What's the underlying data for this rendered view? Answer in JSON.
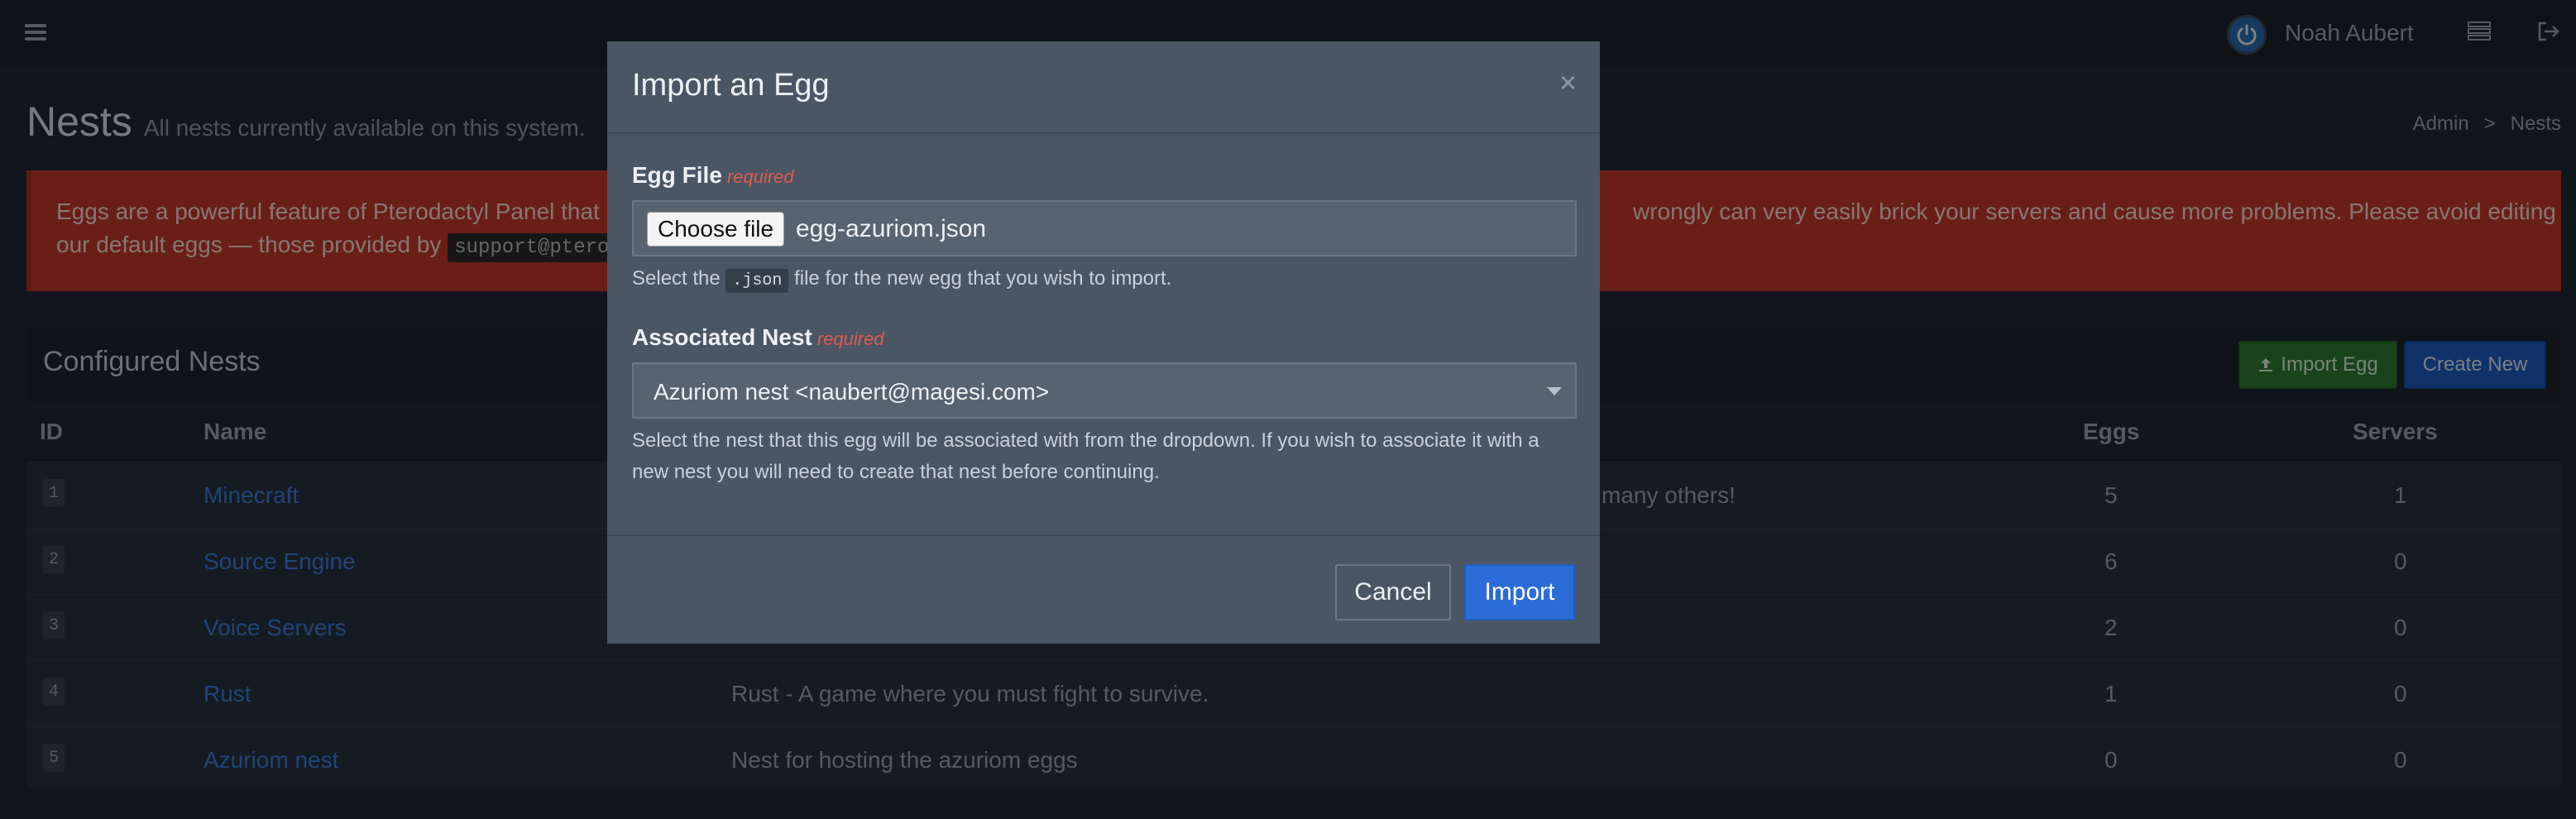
{
  "topbar": {
    "user_name": "Noah Aubert"
  },
  "page": {
    "title": "Nests",
    "subtitle": "All nests currently available on this system.",
    "breadcrumb": [
      "Admin",
      ">",
      "Nests"
    ]
  },
  "alert": {
    "left_line1": "Eggs are a powerful feature of Pterodactyl Panel that",
    "left_line2": "our default eggs — those provided by",
    "left_code": "support@ptero",
    "right_text": "wrongly can very easily brick your servers and cause more problems. Please avoid editing"
  },
  "box": {
    "title": "Configured Nests",
    "import_egg_label": "Import Egg",
    "create_new_label": "Create New",
    "columns": {
      "id": "ID",
      "name": "Name",
      "eggs": "Eggs",
      "servers": "Servers"
    },
    "rows": [
      {
        "id": "1",
        "name": "Minecraft",
        "description": "many others!",
        "eggs": "5",
        "servers": "1"
      },
      {
        "id": "2",
        "name": "Source Engine",
        "description": "",
        "eggs": "6",
        "servers": "0"
      },
      {
        "id": "3",
        "name": "Voice Servers",
        "description": "",
        "eggs": "2",
        "servers": "0"
      },
      {
        "id": "4",
        "name": "Rust",
        "description": "Rust - A game where you must fight to survive.",
        "eggs": "1",
        "servers": "0"
      },
      {
        "id": "5",
        "name": "Azuriom nest",
        "description": "Nest for hosting the azuriom eggs",
        "eggs": "0",
        "servers": "0"
      }
    ]
  },
  "modal": {
    "title": "Import an Egg",
    "close_glyph": "×",
    "egg_file": {
      "label": "Egg File",
      "required": "required",
      "choose_label": "Choose file",
      "file_name": "egg-azuriom.json",
      "help_before": "Select the",
      "help_code": ".json",
      "help_after": "file for the new egg that you wish to import."
    },
    "nest": {
      "label": "Associated Nest",
      "required": "required",
      "selected": "Azuriom nest <naubert@magesi.com>",
      "help_line1": "Select the nest that this egg will be associated with from the dropdown. If you wish to associate it with a",
      "help_line2": "new nest you will need to create that nest before continuing."
    },
    "cancel_label": "Cancel",
    "import_label": "Import"
  }
}
